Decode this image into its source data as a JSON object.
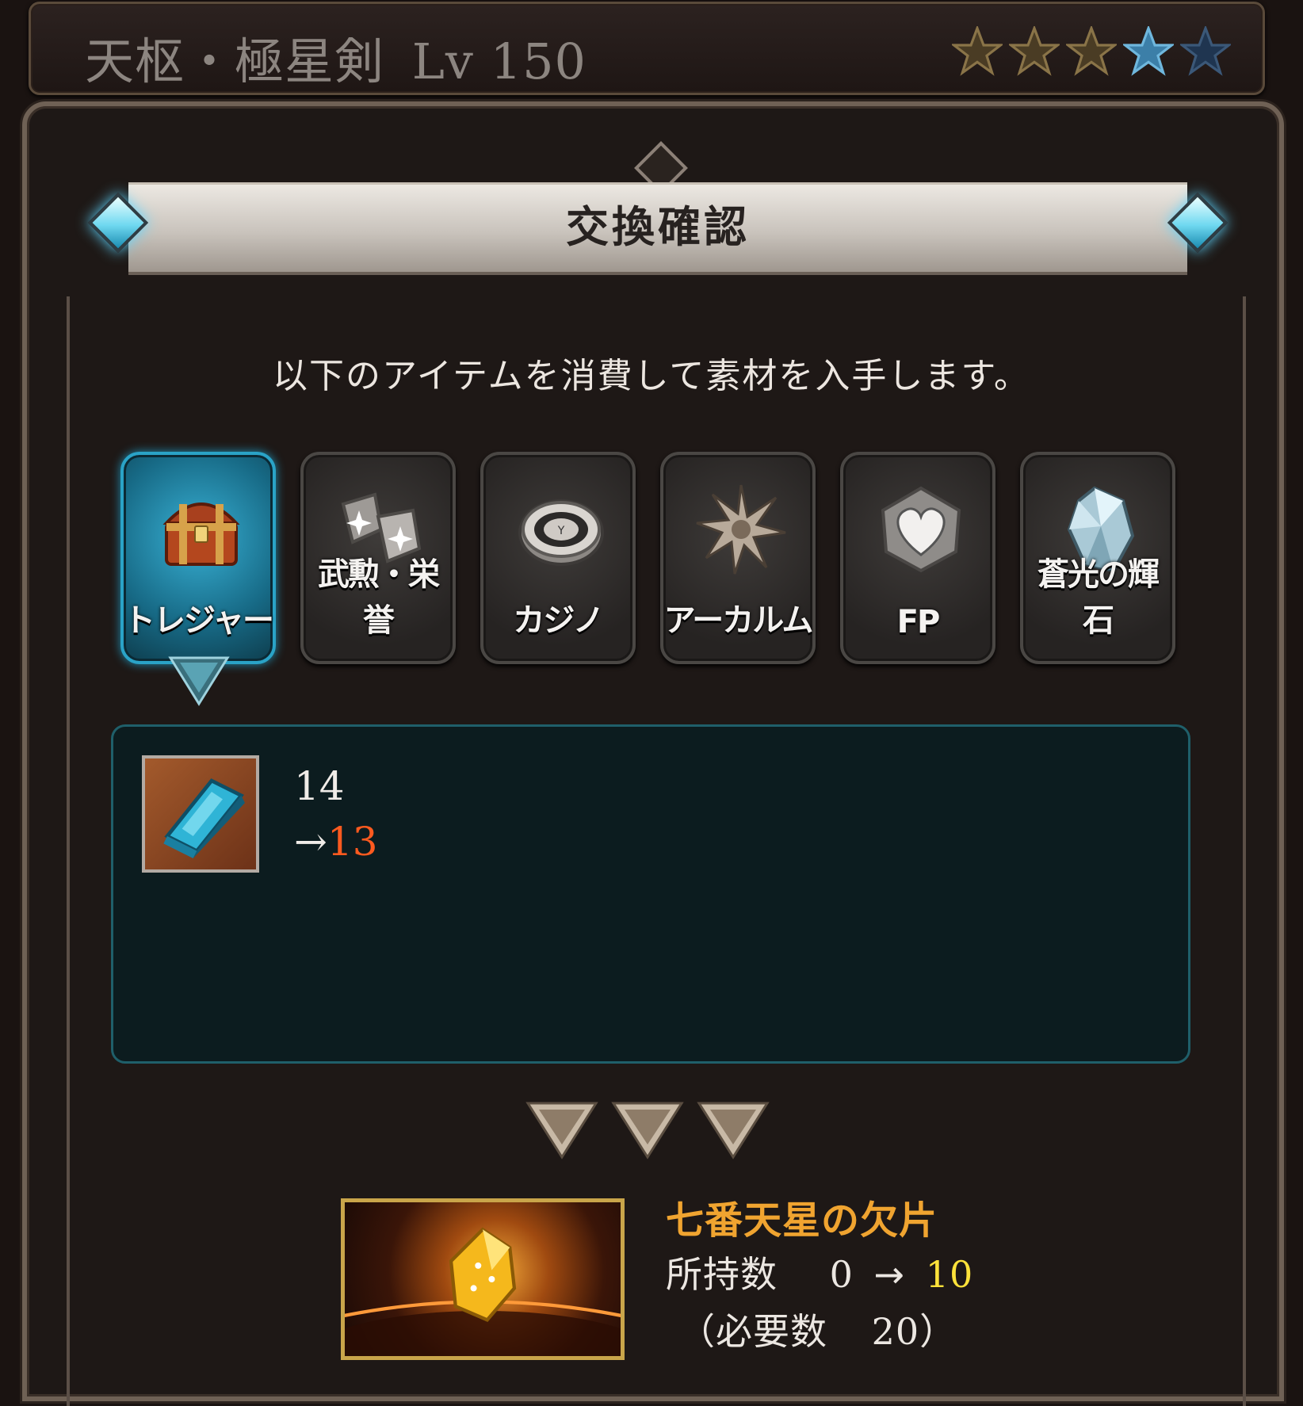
{
  "header": {
    "weapon_name": "天枢・極星剣",
    "level": "Lv 150",
    "stars_filled": 3,
    "stars_total": 5
  },
  "modal": {
    "title": "交換確認",
    "description": "以下のアイテムを消費して素材を入手します。"
  },
  "tabs": [
    {
      "label": "トレジャー",
      "icon": "treasure-chest-icon",
      "active": true
    },
    {
      "label": "武勲・栄誉",
      "icon": "medal-icon",
      "active": false
    },
    {
      "label": "カジノ",
      "icon": "casino-chip-icon",
      "active": false
    },
    {
      "label": "アーカルム",
      "icon": "arcarum-star-icon",
      "active": false
    },
    {
      "label": "FP",
      "icon": "heart-icon",
      "active": false
    },
    {
      "label": "蒼光の輝石",
      "icon": "crystal-icon",
      "active": false
    }
  ],
  "consumed_item": {
    "icon": "blue-ingot-icon",
    "current": "14",
    "arrow": "→",
    "after": "13"
  },
  "reward": {
    "icon": "golden-shard-icon",
    "name": "七番天星の欠片",
    "owned_label": "所持数",
    "owned_before": "0",
    "arrow": "→",
    "owned_after": "10",
    "required_label": "（必要数",
    "required_value": "20）"
  },
  "colors": {
    "accent_cyan": "#2aa3c7",
    "reward_name": "#f0a430",
    "count_after": "#ff5a1f",
    "owned_after": "#ffe23a"
  }
}
